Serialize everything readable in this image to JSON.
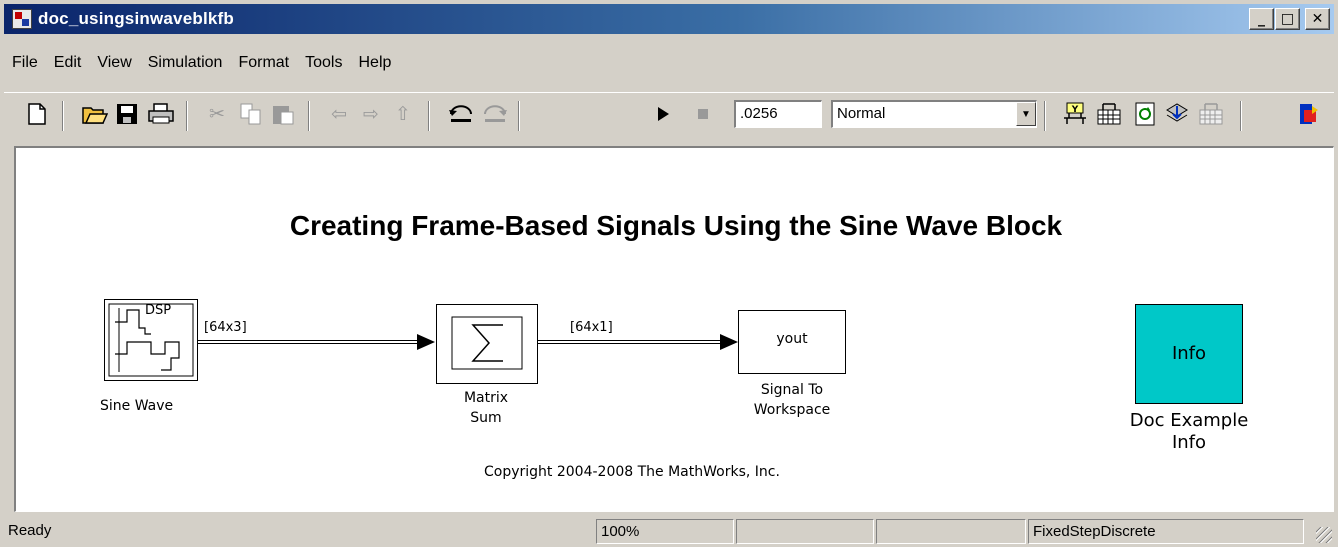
{
  "window": {
    "title": "doc_usingsinwaveblkfb",
    "icons": {
      "app": "simulink-model-icon",
      "minimize": "minimize-icon",
      "maximize": "maximize-icon",
      "close": "close-icon"
    },
    "min_glyph": "_",
    "max_glyph": "□",
    "close_glyph": "✕"
  },
  "menu": {
    "items": [
      "File",
      "Edit",
      "View",
      "Simulation",
      "Format",
      "Tools",
      "Help"
    ]
  },
  "toolbar": {
    "stop_time": ".0256",
    "sim_mode": "Normal",
    "dropdown_glyph": "▼",
    "icons": [
      "new-icon",
      "open-icon",
      "save-icon",
      "print-icon",
      "cut-icon",
      "copy-icon",
      "paste-icon",
      "back-icon",
      "forward-icon",
      "up-icon",
      "undo-icon",
      "redo-icon",
      "start-simulation-icon",
      "stop-simulation-icon",
      "library-browser-icon",
      "model-explorer-icon",
      "update-diagram-icon",
      "build-icon",
      "debug-icon",
      "toggle-icon"
    ]
  },
  "diagram": {
    "title": "Creating Frame-Based Signals Using the Sine Wave Block",
    "blocks": {
      "sine_wave": {
        "label": "Sine Wave",
        "tag": "DSP"
      },
      "matrix_sum": {
        "label_line1": "Matrix",
        "label_line2": "Sum"
      },
      "signal_to_workspace": {
        "text": "yout",
        "label_line1": "Signal To",
        "label_line2": "Workspace"
      },
      "doc_info": {
        "text": "Info",
        "label_line1": "Doc Example",
        "label_line2": "Info",
        "color": "#00c8c8"
      }
    },
    "signals": {
      "sine_out": "[64x3]",
      "sum_out": "[64x1]"
    },
    "copyright": "Copyright 2004-2008 The MathWorks, Inc."
  },
  "status": {
    "state": "Ready",
    "zoom": "100%",
    "solver": "FixedStepDiscrete"
  }
}
